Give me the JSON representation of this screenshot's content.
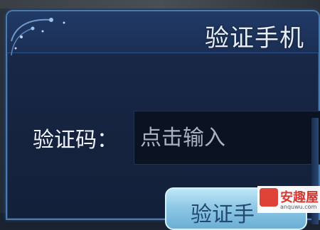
{
  "dialog": {
    "title": "验证手机"
  },
  "form": {
    "code_label": "验证码：",
    "code_placeholder": "点击输入"
  },
  "actions": {
    "verify_label": "验证手"
  },
  "watermark": {
    "brand": "安趣屋",
    "url": "anquwu.com"
  },
  "colors": {
    "dialog_border": "#4a7bb0",
    "dialog_bg": "#1a2a4a",
    "input_bg": "#0b1322",
    "button_bg": "#8fc8e6",
    "watermark_red": "#d8332a"
  }
}
